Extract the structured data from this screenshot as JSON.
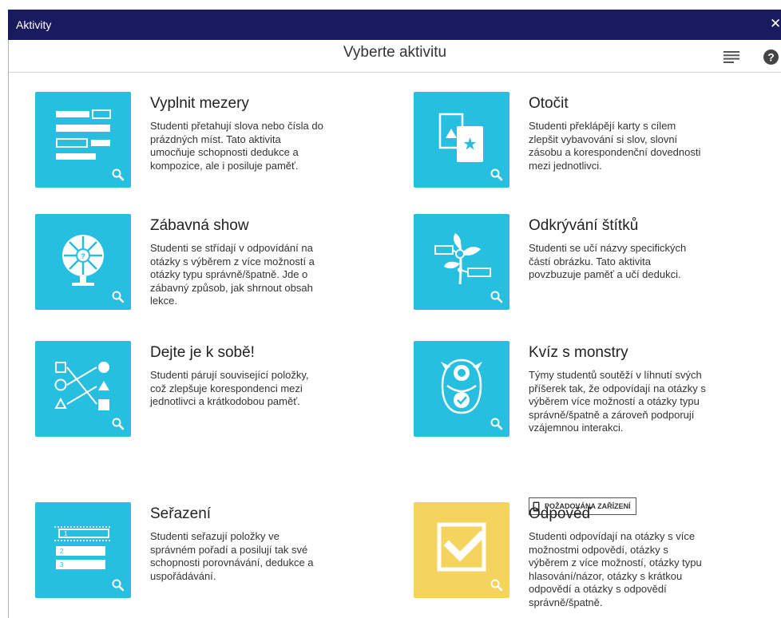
{
  "window": {
    "title": "Aktivity",
    "close_glyph": "✕"
  },
  "header": {
    "title": "Vyberte aktivitu",
    "menu_icon": "list-icon",
    "help_icon": "help-icon",
    "help_glyph": "?"
  },
  "colors": {
    "titlebar": "#1a1a5e",
    "tile_blue": "#26bfe0",
    "tile_yellow": "#f4d35e"
  },
  "activities": [
    {
      "name": "Vyplnit mezery",
      "description": "Studenti přetahují slova nebo čísla do prázdných míst. Tato aktivita umocňuje schopnosti dedukce a kompozice, ale i posiluje paměť.",
      "icon": "fill-blanks-icon"
    },
    {
      "name": "Otočit",
      "description": "Studenti překlápějí karty s cílem zlepšit vybavování si slov, slovní zásobu a korespondenční dovednosti mezi jednotlivci.",
      "icon": "flip-cards-icon"
    },
    {
      "name": "Zábavná show",
      "description": "Studenti se střídají v odpovídání na otázky s výběrem z více možností a otázky typu správně/špatně. Jde o zábavný způsob, jak shrnout obsah lekce.",
      "icon": "wheel-icon"
    },
    {
      "name": "Odkrývání štítků",
      "description": "Studenti se učí názvy specifických částí obrázku. Tato aktivita povzbuzuje paměť a učí dedukci.",
      "icon": "plant-labels-icon"
    },
    {
      "name": "Dejte je k sobě!",
      "description": "Studenti párují související položky, což zlepšuje korespondenci mezi jednotlivci a krátkodobou paměť.",
      "icon": "matching-icon"
    },
    {
      "name": "Kvíz s monstry",
      "description": "Týmy studentů soutěží v líhnutí svých příšerek tak, že odpovídají na otázky s výběrem více možností a otázky typu správně/špatně a zároveň podporují vzájemnou interakci.",
      "icon": "monster-icon",
      "badge": "POŽADOVÁNA ZAŘÍZENÍ"
    },
    {
      "name": "Seřazení",
      "description": "Studenti seřazují položky ve správném pořadí a posilují tak své schopnosti porovnávání, dedukce a uspořádávání.",
      "icon": "ordering-icon",
      "order_labels": [
        "1",
        "2",
        "3"
      ]
    },
    {
      "name": "Odpověď",
      "description": "Studenti odpovídají na otázky s více možnostmi odpovědí, otázky s výběrem z více možností, otázky typu hlasování/názor, otázky s krátkou odpovědí a otázky s odpovědí správně/špatně.",
      "icon": "checkbox-icon"
    }
  ],
  "zoom_icon": "zoom-icon"
}
